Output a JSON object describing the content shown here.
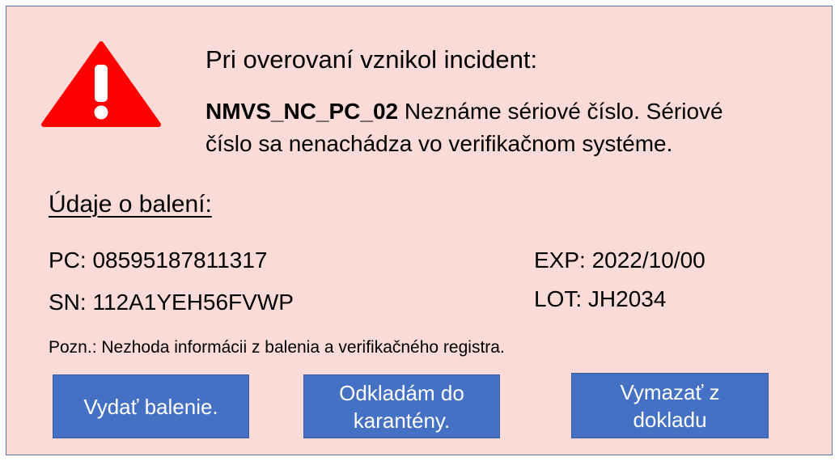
{
  "incident": {
    "title": "Pri overovaní vznikol incident:",
    "code": "NMVS_NC_PC_02",
    "message_part1": " Neznáme sériové číslo. Sériové",
    "message_part2": "číslo sa nenachádza vo verifikačnom systéme."
  },
  "package": {
    "heading": "Údaje o balení:",
    "pc": "PC: 08595187811317",
    "sn": "SN: 112A1YEH56FVWP",
    "exp": "EXP: 2022/10/00",
    "lot": "LOT: JH2034"
  },
  "note": "Pozn.: Nezhoda informácii z balenia a verifikačného registra.",
  "buttons": {
    "release": "Vydať balenie.",
    "quarantine_line1": "Odkladám do",
    "quarantine_line2": "karantény.",
    "delete_line1": "Vymazať z",
    "delete_line2": "dokladu"
  },
  "colors": {
    "panel_background": "#fadbd8",
    "panel_border": "#5b74b1",
    "warning_red": "#ff0000",
    "button_blue": "#4471c4"
  },
  "icons": {
    "warning": "warning-triangle-icon"
  }
}
